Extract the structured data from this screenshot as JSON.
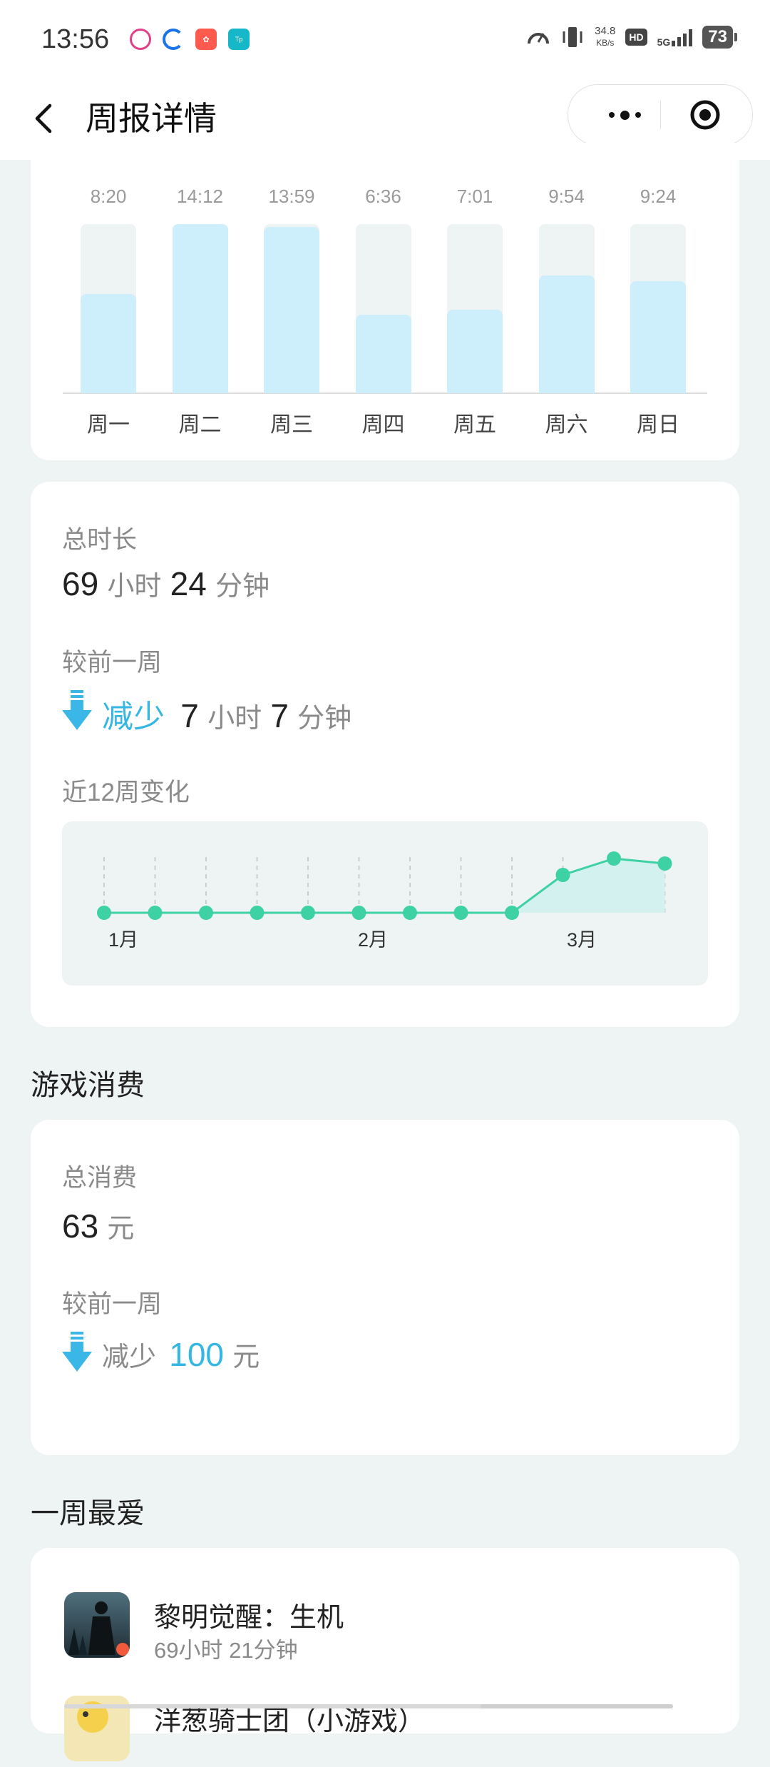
{
  "status_bar": {
    "time": "13:56",
    "net_speed_value": "34.8",
    "net_speed_unit": "KB/s",
    "hd": "HD",
    "network": "5G",
    "battery": "73",
    "notification_icons": [
      "app-a-icon",
      "browser-icon",
      "app-b-icon",
      "app-c-icon"
    ]
  },
  "header": {
    "title": "周报详情",
    "back_icon": "chevron-left-icon",
    "more_icon": "more-dots-icon",
    "close_icon": "target-icon"
  },
  "weekly_chart": {
    "chart_data": {
      "type": "bar",
      "categories": [
        "周一",
        "周二",
        "周三",
        "周四",
        "周五",
        "周六",
        "周日"
      ],
      "labels": [
        "8:20",
        "14:12",
        "13:59",
        "6:36",
        "7:01",
        "9:54",
        "9:24"
      ],
      "values_minutes": [
        500,
        852,
        839,
        396,
        421,
        594,
        564
      ],
      "ylim": [
        0,
        852
      ]
    }
  },
  "summary": {
    "total_label": "总时长",
    "total_hours": "69",
    "hours_unit": "小时",
    "total_minutes": "24",
    "minutes_unit": "分钟",
    "compare_label": "较前一周",
    "change_word": "减少",
    "change_hours": "7",
    "change_minutes": "7",
    "trend_label": "近12周变化",
    "trend_chart": {
      "chart_data": {
        "type": "line",
        "points": 12,
        "month_labels": [
          "1月",
          "2月",
          "3月"
        ],
        "color": "#3dd1a4"
      }
    }
  },
  "spending": {
    "section_title": "游戏消费",
    "total_label": "总消费",
    "total_value": "63",
    "currency_unit": "元",
    "compare_label": "较前一周",
    "change_word": "减少",
    "change_value": "100"
  },
  "favorites": {
    "section_title": "一周最爱",
    "items": [
      {
        "name": "黎明觉醒：生机",
        "time": "69小时 21分钟"
      },
      {
        "name": "洋葱骑士团（小游戏）",
        "time": ""
      }
    ]
  },
  "colors": {
    "accent_blue": "#35b6e3",
    "bar_fill": "#cdeefb",
    "trend_green": "#3dd1a4",
    "page_bg": "#eef4f3"
  }
}
